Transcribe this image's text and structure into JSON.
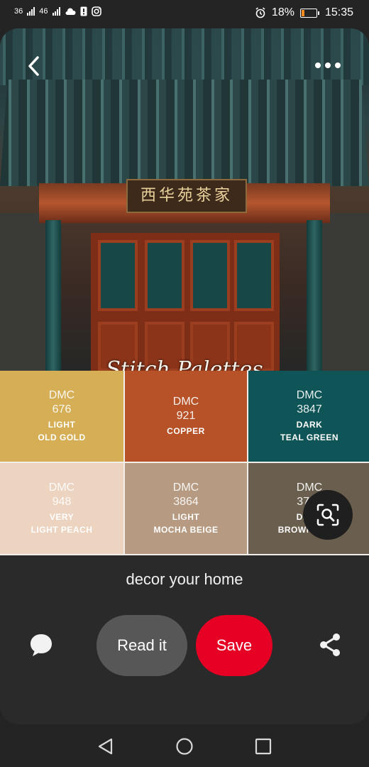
{
  "status_bar": {
    "signal_1": "36",
    "signal_2": "46",
    "battery_percent": "18%",
    "time": "15:35",
    "icons": [
      "signal-icon",
      "signal-icon",
      "cloud-icon",
      "sim-warning-icon",
      "instagram-icon",
      "alarm-icon",
      "battery-icon"
    ]
  },
  "pin": {
    "image": {
      "sign_text": "西华苑茶家",
      "brand_text": "Stitch Palettes"
    },
    "palette": [
      {
        "brand": "DMC",
        "number": "676",
        "name_line1": "LIGHT",
        "name_line2": "OLD GOLD",
        "color": "#d6ae55"
      },
      {
        "brand": "DMC",
        "number": "921",
        "name_line1": "",
        "name_line2": "COPPER",
        "color": "#b65128"
      },
      {
        "brand": "DMC",
        "number": "3847",
        "name_line1": "DARK",
        "name_line2": "TEAL GREEN",
        "color": "#0f5557"
      },
      {
        "brand": "DMC",
        "number": "948",
        "name_line1": "VERY",
        "name_line2": "LIGHT PEACH",
        "color": "#ecd4c1"
      },
      {
        "brand": "DMC",
        "number": "3864",
        "name_line1": "LIGHT",
        "name_line2": "MOCHA BEIGE",
        "color": "#b69b82"
      },
      {
        "brand": "DMC",
        "number": "3781",
        "name_line1": "DARK",
        "name_line2": "BROWN GRAY",
        "color": "#6a5f4e"
      }
    ],
    "caption": "decor your home"
  },
  "actions": {
    "read_it_label": "Read it",
    "save_label": "Save"
  },
  "colors": {
    "save_red": "#e60023",
    "read_gray": "#575757",
    "background": "#242424"
  }
}
